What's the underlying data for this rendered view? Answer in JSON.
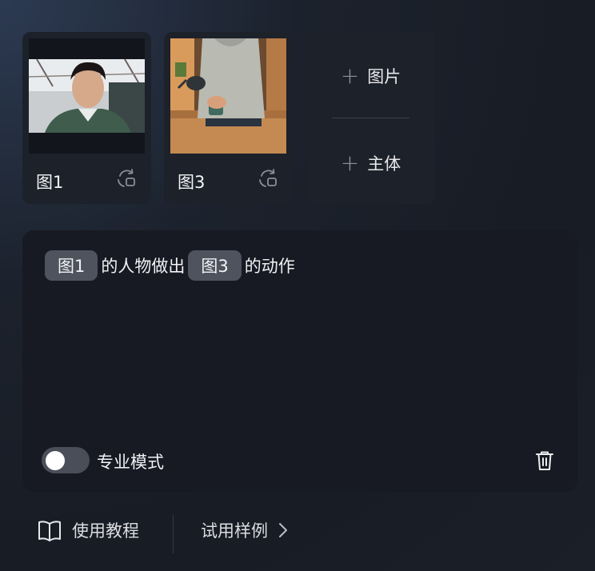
{
  "reference_cards": [
    {
      "label": "图1",
      "image": "young man in green shirt looking down",
      "action_icon": "replace-icon"
    },
    {
      "label": "图3",
      "image": "man pouring coffee from kettle",
      "action_icon": "replace-icon"
    }
  ],
  "add_panel": {
    "image_label": "图片",
    "subject_label": "主体"
  },
  "prompt": {
    "tag1": "图1",
    "text1": "的人物做出",
    "tag2": "图3",
    "text2": "的动作"
  },
  "pro_mode": {
    "label": "专业模式",
    "enabled": false
  },
  "footer": {
    "tutorial_label": "使用教程",
    "examples_label": "试用样例"
  },
  "colors": {
    "card_bg": "#1d212a",
    "prompt_bg": "#171a22",
    "tag_bg": "#4f535e",
    "toggle_off": "#4a4e58"
  }
}
